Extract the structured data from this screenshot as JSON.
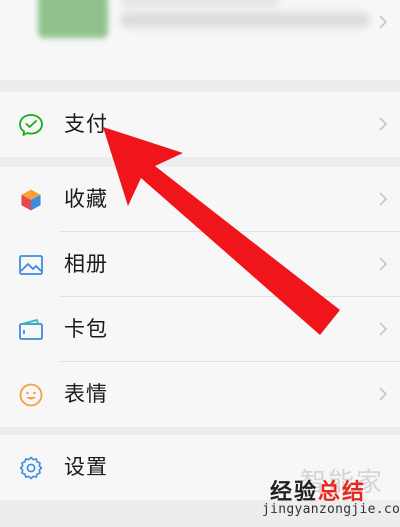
{
  "menu": {
    "pay": "支付",
    "favorites": "收藏",
    "album": "相册",
    "cards": "卡包",
    "stickers": "表情",
    "settings": "设置"
  },
  "watermark": {
    "faint": "智能家",
    "logo_part1": "经验",
    "logo_part2": "总结",
    "url": "jingyanzongjie.com"
  },
  "colors": {
    "background": "#ededed",
    "row": "#f7f7f7",
    "pay_icon": "#1aad19",
    "arrow": "#f0151b"
  },
  "icons": {
    "pay": "wechat-pay-icon",
    "favorites": "cube-icon",
    "album": "image-icon",
    "cards": "wallet-icon",
    "stickers": "smiley-icon",
    "settings": "gear-icon"
  }
}
